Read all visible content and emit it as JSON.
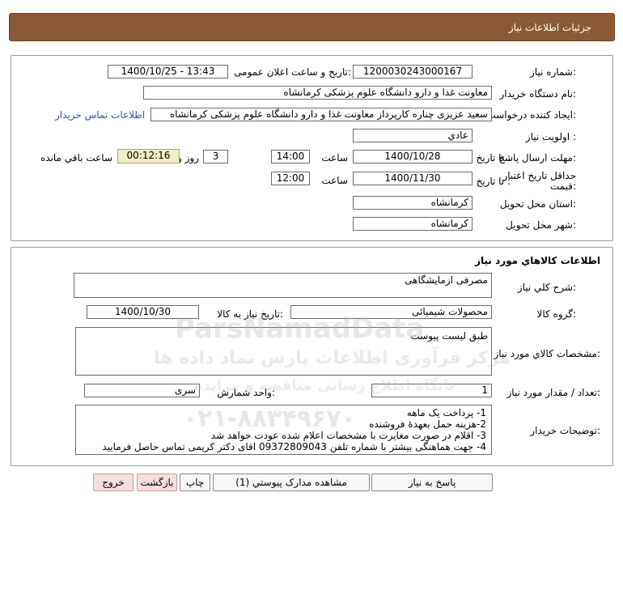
{
  "header": {
    "title": "جزئيات اطلاعات نياز"
  },
  "info": {
    "need_number_label": "شماره نياز:",
    "need_number": "1200030243000167",
    "announce_label": "تاريخ و ساعت اعلان عمومی:",
    "announce_value": "1400/10/25 - 13:43",
    "buyer_org_label": "نام دستگاه خريدار:",
    "buyer_org": "معاونت غذا و دارو دانشگاه علوم پزشکی کرمانشاه",
    "creator_label": "ايجاد کننده درخواست:",
    "creator": "سعيد عزيزی چناره کارپرداز معاونت غذا و دارو دانشگاه علوم پزشکی کرمانشاه",
    "contact_link": "اطلاعات تماس خريدار",
    "priority_label": "اولويت نياز :",
    "priority": "عادي",
    "deadline_label": "مهلت ارسال پاسخ:",
    "to_date_label": "تا تاريخ :",
    "deadline_date": "1400/10/28",
    "time_label": "ساعت",
    "deadline_time": "14:00",
    "days_value": "3",
    "days_label": "روز و",
    "timer": "00:12:16",
    "remaining_label": "ساعت باقي مانده",
    "validity_label_1": "حداقل تاريخ اعتبار",
    "validity_label_2": "قيمت:",
    "validity_date": "1400/11/30",
    "validity_time": "12:00",
    "province_label": "استان محل تحويل:",
    "province": "کرمانشاه",
    "city_label": "شهر محل تحويل:",
    "city": "کرمانشاه"
  },
  "goods": {
    "section_title": "اطلاعات کالاهاي مورد نياز",
    "general_desc_label": "شرح کلي نياز:",
    "general_desc": "مصرفی ازمایشگاهی",
    "group_label": "گروه کالا:",
    "group": "محصولات شیمیائی",
    "need_date_label": "تاريخ نياز به کالا:",
    "need_date": "1400/10/30",
    "specs_label": "مشخصات کالاي مورد نياز:",
    "specs": "طبق لیست پیوست",
    "quantity_label": "تعداد / مقدار مورد نياز:",
    "quantity": "1",
    "unit_label": "واحد شمارش:",
    "unit": "سری",
    "buyer_notes_label": "توضيحات خريدار:",
    "buyer_notes": [
      "1- پرداخت یک ماهه",
      "2-هزینه حمل بعهدۀ فروشنده",
      "3- اقلام در صورت مغایرت با مشخصات اعلام شده عودت خواهد شد",
      "4- جهت هماهنگی بیشتر با شماره تلفن 09372809043 اقای دکتر کریمی تماس حاصل فرمایید"
    ]
  },
  "buttons": {
    "reply": "پاسخ به نياز",
    "attachments": "مشاهده مدارک پيوستي (1)",
    "print": "چاپ",
    "back": "بازگشت",
    "exit": "خروج"
  },
  "watermark": {
    "line1": "ParsNamadData",
    "line2": "مرکز فرآوری اطلاعات پارس نماد داده ها",
    "line3": "پایگاه اطلاع رسانی مناقصه و مزایده",
    "phone": "۰۲۱-۸۸۳۴۹۶۷۰"
  }
}
